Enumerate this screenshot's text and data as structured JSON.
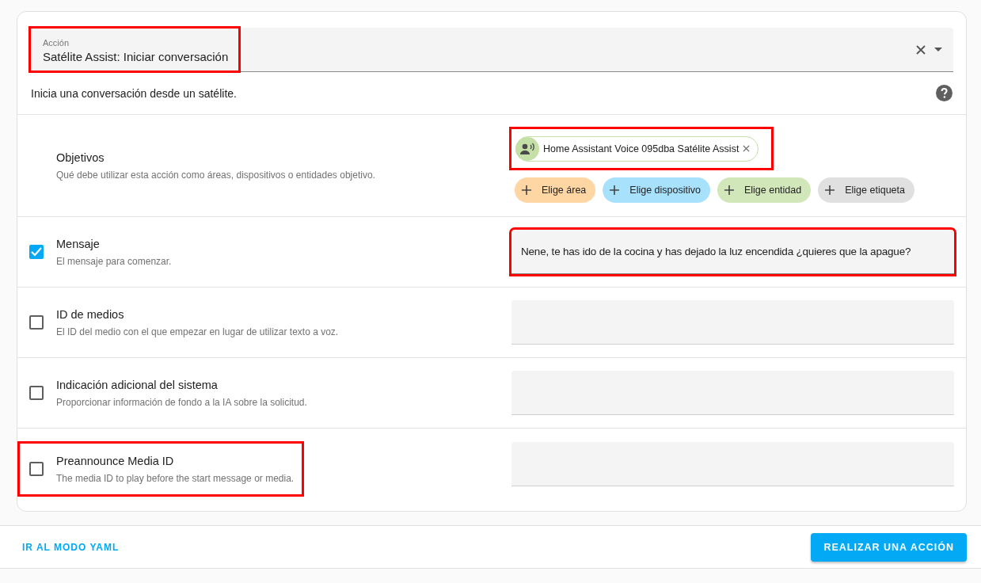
{
  "action_field": {
    "label": "Acción",
    "value": "Satélite Assist: Iniciar conversación",
    "highlighted": true
  },
  "description": "Inicia una conversación desde un satélite.",
  "targets": {
    "title": "Objetivos",
    "description": "Qué debe utilizar esta acción como áreas, dispositivos o entidades objetivo.",
    "selected_chip": {
      "label": "Home Assistant Voice 095dba Satélite Assist",
      "highlighted": true
    },
    "pickers": [
      {
        "label": "Elige área",
        "color": "#fed6a4"
      },
      {
        "label": "Elige dispositivo",
        "color": "#a8e1fb"
      },
      {
        "label": "Elige entidad",
        "color": "#d2e7b9"
      },
      {
        "label": "Elige etiqueta",
        "color": "#e0e0e0"
      }
    ]
  },
  "fields": [
    {
      "title": "Mensaje",
      "description": "El mensaje para comenzar.",
      "checked": true,
      "value": "Nene, te has ido de la cocina y has dejado la luz encendida ¿quieres que la apague?",
      "field_highlighted": true,
      "label_highlighted": false
    },
    {
      "title": "ID de medios",
      "description": "El ID del medio con el que empezar en lugar de utilizar texto a voz.",
      "checked": false,
      "field_highlighted": false,
      "label_highlighted": false
    },
    {
      "title": "Indicación adicional del sistema",
      "description": "Proporcionar información de fondo a la IA sobre la solicitud.",
      "checked": false,
      "field_highlighted": false,
      "label_highlighted": false
    },
    {
      "title": "Preannounce Media ID",
      "description": "The media ID to play before the start message or media.",
      "checked": false,
      "field_highlighted": false,
      "label_highlighted": true
    }
  ],
  "footer": {
    "link": "IR AL MODO YAML",
    "button": "REALIZAR UNA ACCIÓN"
  }
}
